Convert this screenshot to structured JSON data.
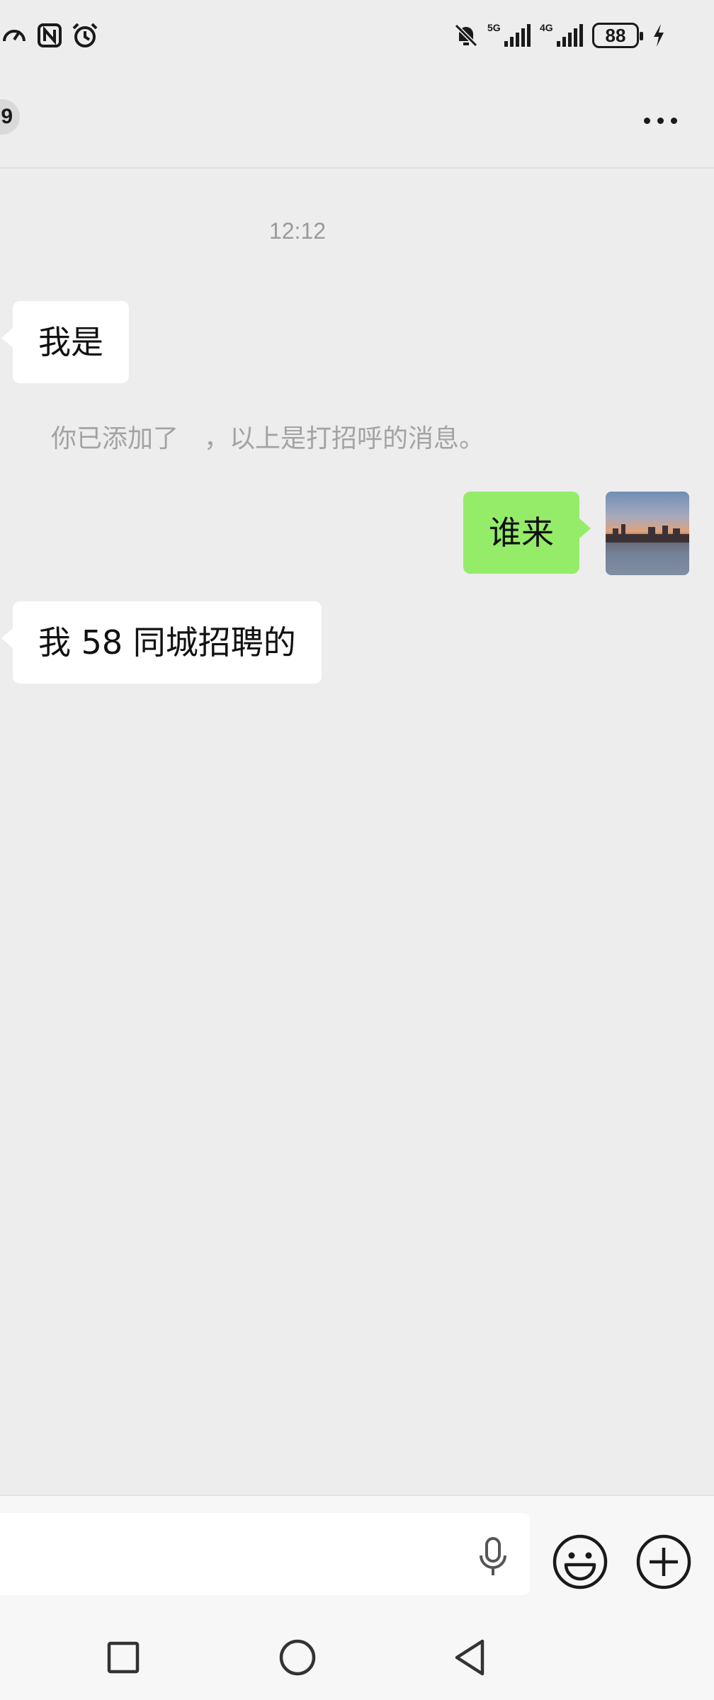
{
  "status_bar": {
    "battery_level": "88",
    "network_1": "5G",
    "network_2": "4G",
    "icons_left": [
      "speedometer-icon",
      "nfc-icon",
      "alarm-icon"
    ],
    "icons_right": [
      "mute-icon",
      "signal-5g-icon",
      "signal-4g-icon",
      "battery-icon",
      "charging-icon"
    ]
  },
  "header": {
    "back_badge": "9",
    "more_icon": "more-horizontal-icon"
  },
  "chat": {
    "timestamp": "12:12",
    "messages": [
      {
        "side": "received",
        "text": "我是"
      },
      {
        "side": "system",
        "text": "你已添加了　，以上是打招呼的消息。"
      },
      {
        "side": "sent",
        "text": "谁来"
      },
      {
        "side": "received",
        "text": "我 58 同城招聘的"
      }
    ]
  },
  "input_bar": {
    "value": "",
    "voice_icon": "microphone-icon",
    "emoji_icon": "emoji-icon",
    "plus_icon": "plus-circle-icon"
  },
  "nav_bar": {
    "icons": [
      "recents-square-icon",
      "home-circle-icon",
      "back-triangle-icon"
    ]
  },
  "colors": {
    "background": "#ededed",
    "sent_bubble": "#95ec69",
    "received_bubble": "#ffffff",
    "system_text": "#a3a3a3"
  }
}
